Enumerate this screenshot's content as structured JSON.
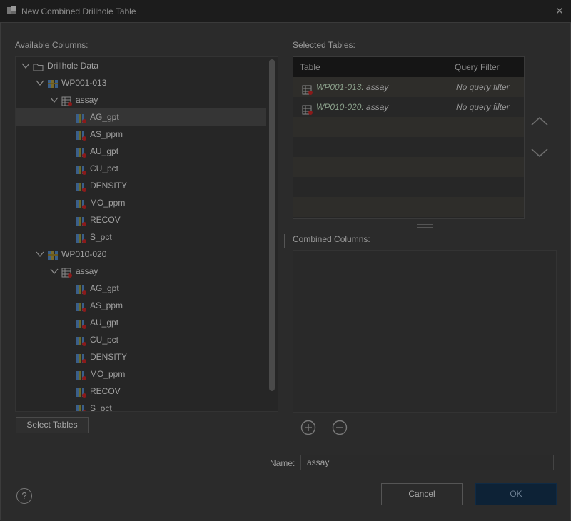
{
  "window": {
    "title": "New Combined Drillhole Table",
    "close_glyph": "✕"
  },
  "available": {
    "label": "Available Columns:",
    "tree": [
      {
        "label": "Drillhole Data",
        "icon": "folder-icon",
        "level": 0,
        "expanded": true
      },
      {
        "label": "WP001-013",
        "icon": "drillhole-set-icon",
        "level": 1,
        "expanded": true
      },
      {
        "label": "assay",
        "icon": "table-icon",
        "level": 2,
        "expanded": true
      },
      {
        "label": "AG_gpt",
        "icon": "column-icon",
        "level": 3,
        "selected": true
      },
      {
        "label": "AS_ppm",
        "icon": "column-icon",
        "level": 3
      },
      {
        "label": "AU_gpt",
        "icon": "column-icon",
        "level": 3
      },
      {
        "label": "CU_pct",
        "icon": "column-icon",
        "level": 3
      },
      {
        "label": "DENSITY",
        "icon": "column-icon",
        "level": 3
      },
      {
        "label": "MO_ppm",
        "icon": "column-icon",
        "level": 3
      },
      {
        "label": "RECOV",
        "icon": "column-icon",
        "level": 3
      },
      {
        "label": "S_pct",
        "icon": "column-icon",
        "level": 3
      },
      {
        "label": "WP010-020",
        "icon": "drillhole-set-icon",
        "level": 1,
        "expanded": true
      },
      {
        "label": "assay",
        "icon": "table-icon",
        "level": 2,
        "expanded": true
      },
      {
        "label": "AG_gpt",
        "icon": "column-icon",
        "level": 3
      },
      {
        "label": "AS_ppm",
        "icon": "column-icon",
        "level": 3
      },
      {
        "label": "AU_gpt",
        "icon": "column-icon",
        "level": 3
      },
      {
        "label": "CU_pct",
        "icon": "column-icon",
        "level": 3
      },
      {
        "label": "DENSITY",
        "icon": "column-icon",
        "level": 3
      },
      {
        "label": "MO_ppm",
        "icon": "column-icon",
        "level": 3
      },
      {
        "label": "RECOV",
        "icon": "column-icon",
        "level": 3
      },
      {
        "label": "S_pct",
        "icon": "column-icon",
        "level": 3
      }
    ],
    "select_tables_label": "Select Tables"
  },
  "selected": {
    "label": "Selected Tables:",
    "columns": [
      "Table",
      "Query Filter"
    ],
    "rows": [
      {
        "set": "WP001-013",
        "table": "assay",
        "filter": "No query filter"
      },
      {
        "set": "WP010-020",
        "table": "assay",
        "filter": "No query filter"
      }
    ],
    "move_up_icon": "chevron-up-icon",
    "move_down_icon": "chevron-down-icon"
  },
  "combined": {
    "label": "Combined Columns:",
    "add_icon": "plus-circle-icon",
    "remove_icon": "minus-circle-icon"
  },
  "name": {
    "label": "Name:",
    "value": "assay"
  },
  "footer": {
    "help_glyph": "?",
    "cancel_label": "Cancel",
    "ok_label": "OK"
  },
  "colors": {
    "accent": "#0d2236",
    "background": "#2b2b2b"
  }
}
